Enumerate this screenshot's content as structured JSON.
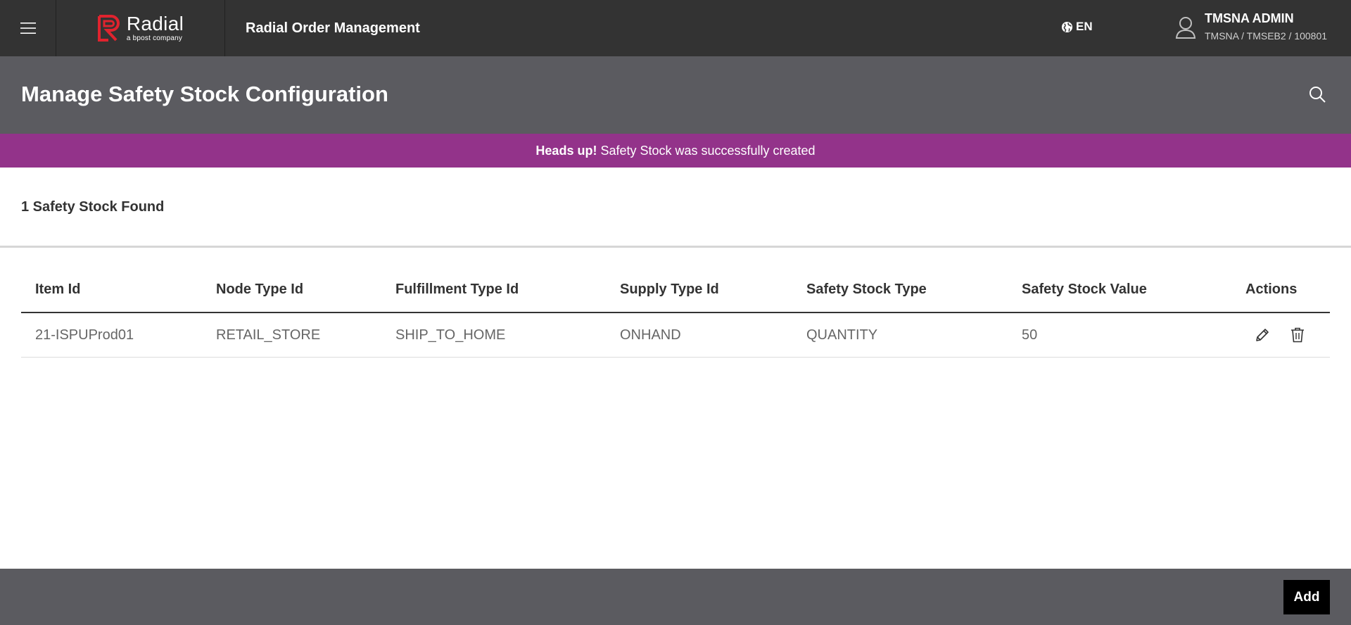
{
  "topbar": {
    "logo_name": "Radial",
    "logo_tagline": "a bpost company",
    "app_title": "Radial Order Management",
    "language": "EN",
    "user_name": "TMSNA ADMIN",
    "user_context": "TMSNA / TMSEB2 / 100801"
  },
  "page": {
    "title": "Manage Safety Stock Configuration"
  },
  "alert": {
    "heading": "Heads up!",
    "message": "Safety Stock was successfully created"
  },
  "results": {
    "count_label": "1 Safety Stock Found"
  },
  "table": {
    "columns": [
      "Item Id",
      "Node Type Id",
      "Fulfillment Type Id",
      "Supply Type Id",
      "Safety Stock Type",
      "Safety Stock Value",
      "Actions"
    ],
    "rows": [
      [
        "21-ISPUProd01",
        "RETAIL_STORE",
        "SHIP_TO_HOME",
        "ONHAND",
        "QUANTITY",
        "50"
      ]
    ]
  },
  "footer": {
    "add_label": "Add"
  },
  "colors": {
    "topbar": "#333333",
    "header": "#5b5b60",
    "alert": "#93338a",
    "logo_red": "#e0232e"
  },
  "icons": [
    "hamburger-icon",
    "radial-logo-icon",
    "globe-icon",
    "user-icon",
    "search-icon",
    "edit-icon",
    "trash-icon"
  ]
}
